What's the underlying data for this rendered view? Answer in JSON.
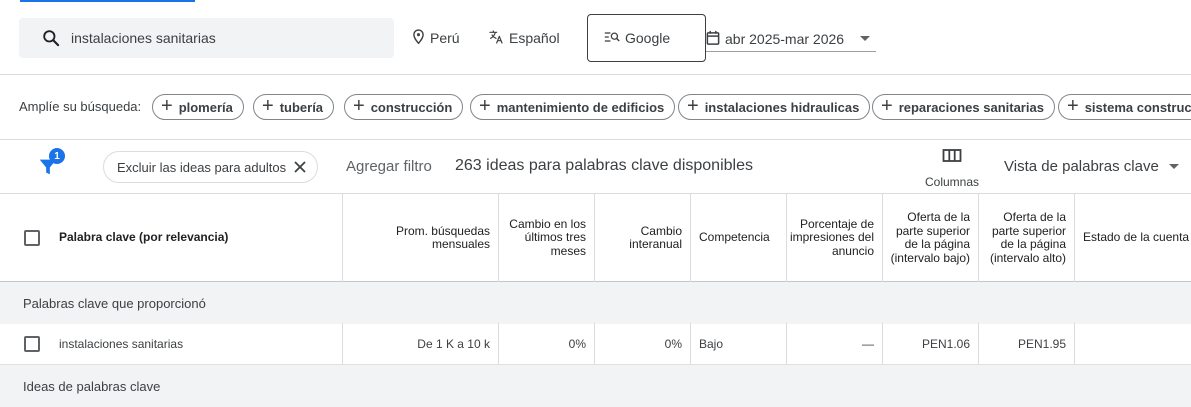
{
  "search": {
    "query": "instalaciones sanitarias",
    "location": "Perú",
    "language": "Español",
    "engine": "Google",
    "date_range": "abr 2025-mar 2026"
  },
  "expand": {
    "label": "Amplíe su búsqueda:",
    "chips": [
      "plomería",
      "tubería",
      "construcción",
      "mantenimiento de edificios",
      "instalaciones hidraulicas",
      "reparaciones sanitarias",
      "sistema construct"
    ]
  },
  "filters": {
    "badge_count": "1",
    "exclude_chip": "Excluir las ideas para adultos",
    "add_filter": "Agregar filtro",
    "ideas_count": "263 ideas para palabras clave disponibles",
    "columns_label": "Columnas",
    "view_label": "Vista de palabras clave"
  },
  "table": {
    "headers": {
      "keyword": "Palabra clave (por relevancia)",
      "avg_searches": "Prom. búsquedas mensuales",
      "three_month": "Cambio en los últimos tres meses",
      "yoy": "Cambio interanual",
      "competition": "Competencia",
      "impression_share": "Porcentaje de impresiones del anuncio",
      "bid_low": "Oferta de la parte superior de la página (intervalo bajo)",
      "bid_high": "Oferta de la parte superior de la página (intervalo alto)",
      "account_status": "Estado de la cuenta"
    },
    "group_provided": "Palabras clave que proporcionó",
    "group_ideas": "Ideas de palabras clave",
    "rows": [
      {
        "keyword": "instalaciones sanitarias",
        "avg_searches": "De 1 K a 10 k",
        "three_month": "0%",
        "yoy": "0%",
        "competition": "Bajo",
        "impression_share": "—",
        "bid_low": "PEN1.06",
        "bid_high": "PEN1.95",
        "account_status": ""
      }
    ]
  },
  "colors": {
    "accent": "#1a73e8",
    "group_bg": "#f1f3f4",
    "search_bg": "#f1f3f4"
  }
}
